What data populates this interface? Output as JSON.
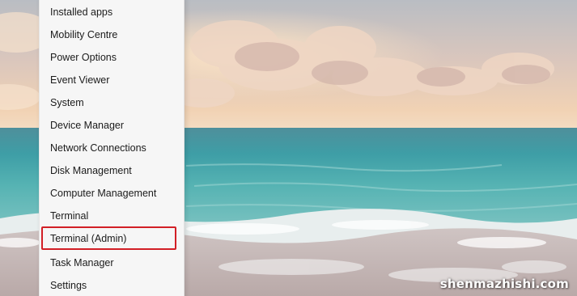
{
  "start_menu": {
    "items": [
      {
        "label": "Installed apps"
      },
      {
        "label": "Mobility Centre"
      },
      {
        "label": "Power Options"
      },
      {
        "label": "Event Viewer"
      },
      {
        "label": "System"
      },
      {
        "label": "Device Manager"
      },
      {
        "label": "Network Connections"
      },
      {
        "label": "Disk Management"
      },
      {
        "label": "Computer Management"
      },
      {
        "label": "Terminal"
      },
      {
        "label": "Terminal (Admin)"
      },
      {
        "label": "Task Manager"
      },
      {
        "label": "Settings"
      }
    ],
    "highlighted_item": "Terminal (Admin)",
    "highlight_color": "#d21f26"
  },
  "watermark": {
    "text": "shenmazhishi.com"
  },
  "colors": {
    "menu_background": "#f6f6f6",
    "sky_top": "#c9c3c3",
    "sea": "#3fa3a8"
  }
}
